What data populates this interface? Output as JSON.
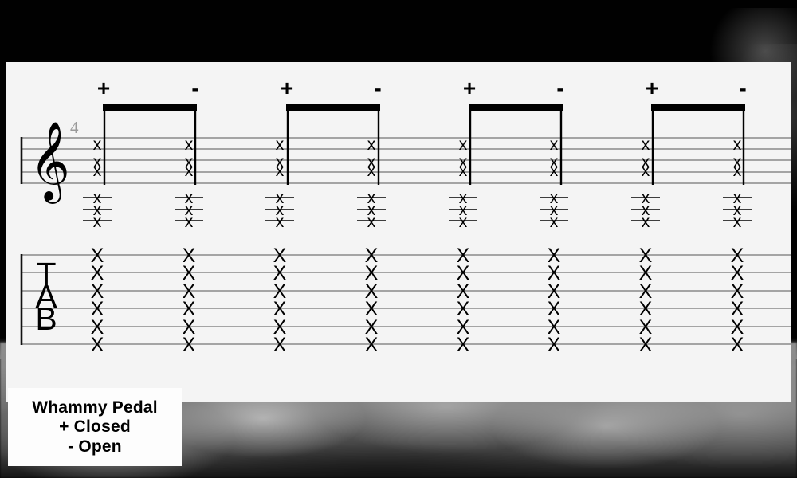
{
  "notation": {
    "measure_number": "4",
    "clef": "treble-clef",
    "tab_label": [
      "T",
      "A",
      "B"
    ],
    "staff_type": "standard-staff-plus-tablature",
    "notehead_symbol": "x",
    "num_note_columns": 8,
    "standard_staff_lines": 5,
    "tab_staff_lines": 6,
    "articulations": [
      "+",
      "-",
      "+",
      "-",
      "+",
      "-",
      "+",
      "-"
    ],
    "beams": 4,
    "columns": [
      {
        "index": 1,
        "articulation": "+",
        "beam_group": 1,
        "beam_pos": "start"
      },
      {
        "index": 2,
        "articulation": "-",
        "beam_group": 1,
        "beam_pos": "end"
      },
      {
        "index": 3,
        "articulation": "+",
        "beam_group": 2,
        "beam_pos": "start"
      },
      {
        "index": 4,
        "articulation": "-",
        "beam_group": 2,
        "beam_pos": "end"
      },
      {
        "index": 5,
        "articulation": "+",
        "beam_group": 3,
        "beam_pos": "start"
      },
      {
        "index": 6,
        "articulation": "-",
        "beam_group": 3,
        "beam_pos": "end"
      },
      {
        "index": 7,
        "articulation": "+",
        "beam_group": 4,
        "beam_pos": "start"
      },
      {
        "index": 8,
        "articulation": "-",
        "beam_group": 4,
        "beam_pos": "end"
      }
    ]
  },
  "legend": {
    "line1": "Whammy Pedal",
    "line2": "+ Closed",
    "line3": "- Open"
  },
  "colors": {
    "sheet_background": "#f4f4f4",
    "legend_background": "#fdfdfd",
    "ink": "#000000",
    "staff_line": "#8a8a8a",
    "measure_number": "#9a9a9a",
    "page_background": "#000000"
  }
}
